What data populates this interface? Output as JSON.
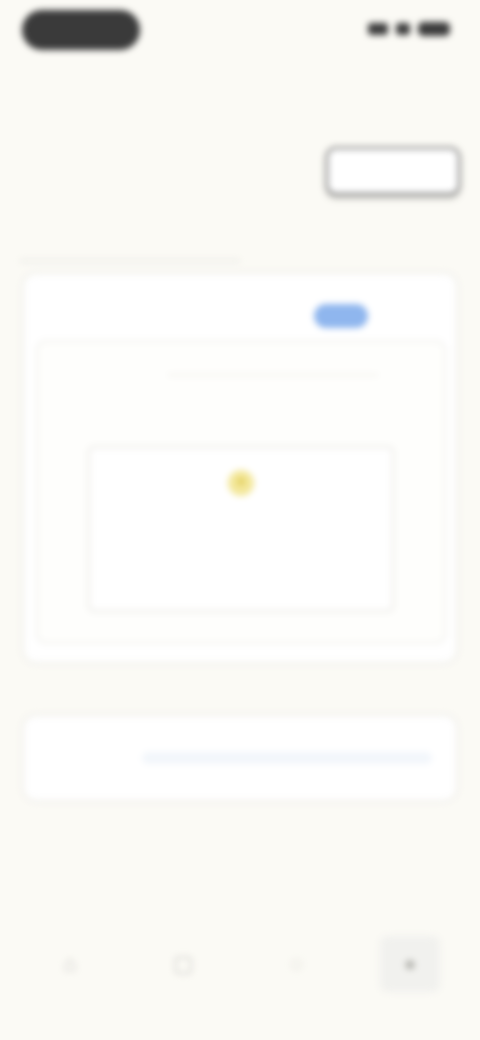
{
  "header": {
    "back_title": ""
  },
  "segments": [
    "",
    "",
    ""
  ],
  "subtabs": [
    "",
    ""
  ],
  "card": {
    "heading": "",
    "more": "",
    "inner_label": ""
  },
  "empty_state": {
    "icon": "lightbulb-icon",
    "title": "",
    "subtitle": "",
    "link": ""
  },
  "section_title": "",
  "card2": {
    "label": ""
  },
  "nav": [
    {
      "icon": "home-icon"
    },
    {
      "icon": "calendar-icon"
    },
    {
      "icon": "chat-icon"
    },
    {
      "icon": "profile-icon"
    }
  ],
  "colors": {
    "background": "#fbfaf5",
    "accent": "#8fb6ee",
    "highlight": "#f3e79a"
  }
}
